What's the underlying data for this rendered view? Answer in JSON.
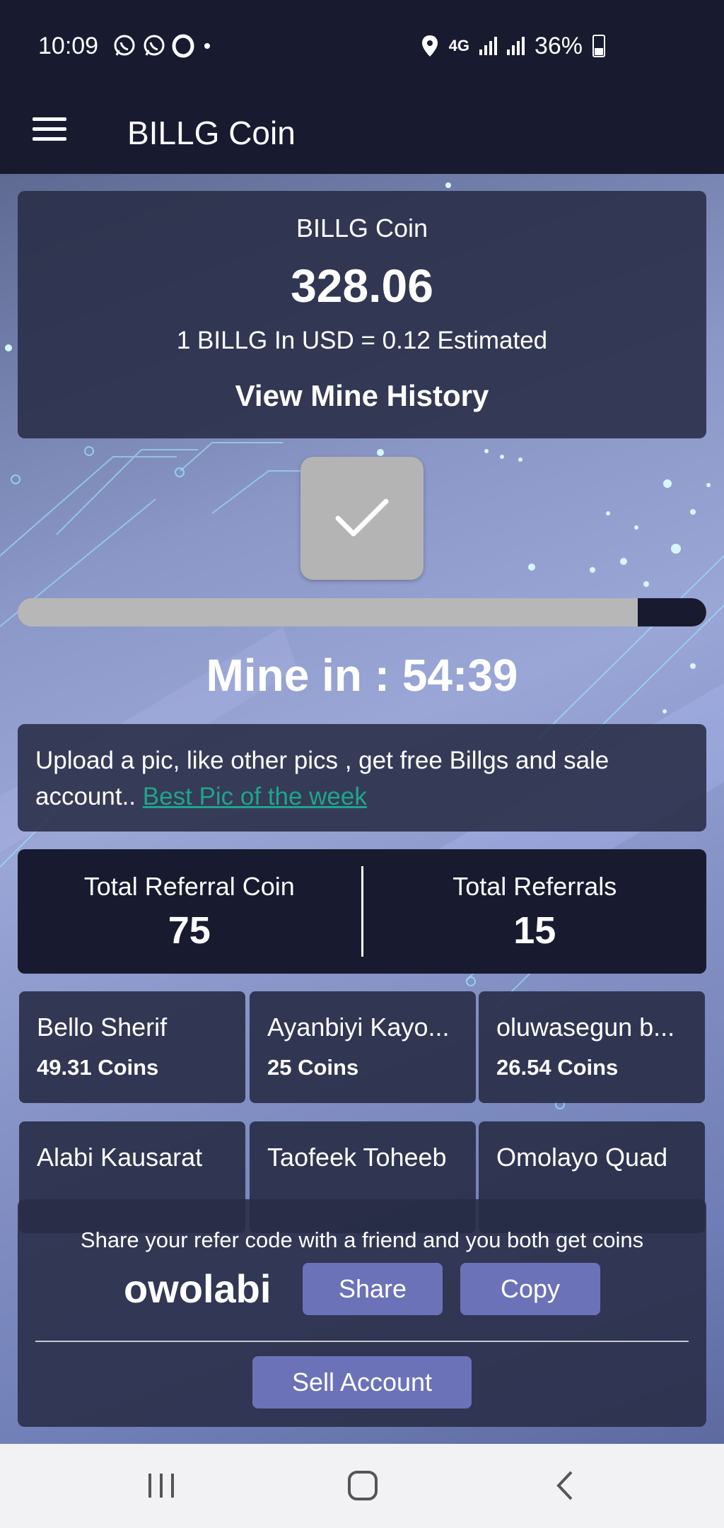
{
  "status_bar": {
    "time": "10:09",
    "network": "4G",
    "battery": "36%",
    "icons": [
      "whatsapp-icon",
      "whatsapp-icon",
      "opera-icon",
      "dot-icon",
      "location-icon",
      "signal-icon",
      "signal-icon",
      "battery-icon"
    ]
  },
  "app_bar": {
    "title": "BILLG Coin",
    "menu_icon": "menu-icon"
  },
  "balance": {
    "label": "BILLG Coin",
    "value": "328.06",
    "rate": "1 BILLG In USD = 0.12 Estimated",
    "history_link": "View Mine History"
  },
  "mining": {
    "button_icon": "checkmark-icon",
    "progress_fraction": 0.9,
    "timer": "Mine in : 54:39"
  },
  "notice": {
    "text": "Upload a pic, like other pics , get free Billgs and sale account.. ",
    "link": "Best Pic of the week "
  },
  "referral_stats": {
    "coin_label": "Total Referral Coin",
    "coin_value": "75",
    "count_label": "Total Referrals",
    "count_value": "15"
  },
  "referrals": [
    {
      "name": "Bello Sherif",
      "coins": "49.31 Coins"
    },
    {
      "name": "Ayanbiyi Kayo...",
      "coins": "25 Coins"
    },
    {
      "name": "oluwasegun b...",
      "coins": "26.54 Coins"
    },
    {
      "name": "Alabi Kausarat",
      "coins": ""
    },
    {
      "name": "Taofeek Toheeb",
      "coins": ""
    },
    {
      "name": "Omolayo Quad",
      "coins": ""
    }
  ],
  "share": {
    "text": "Share your refer code with a friend and you both get coins",
    "code": "owolabi",
    "share_label": "Share",
    "copy_label": "Copy",
    "sell_label": "Sell Account"
  },
  "nav_bar": {
    "icons": [
      "recent-apps-icon",
      "home-icon",
      "back-icon"
    ]
  },
  "colors": {
    "header": "#181b30",
    "card": "#282c46",
    "accent_button": "#6c72b8",
    "link": "#1fa58c"
  }
}
